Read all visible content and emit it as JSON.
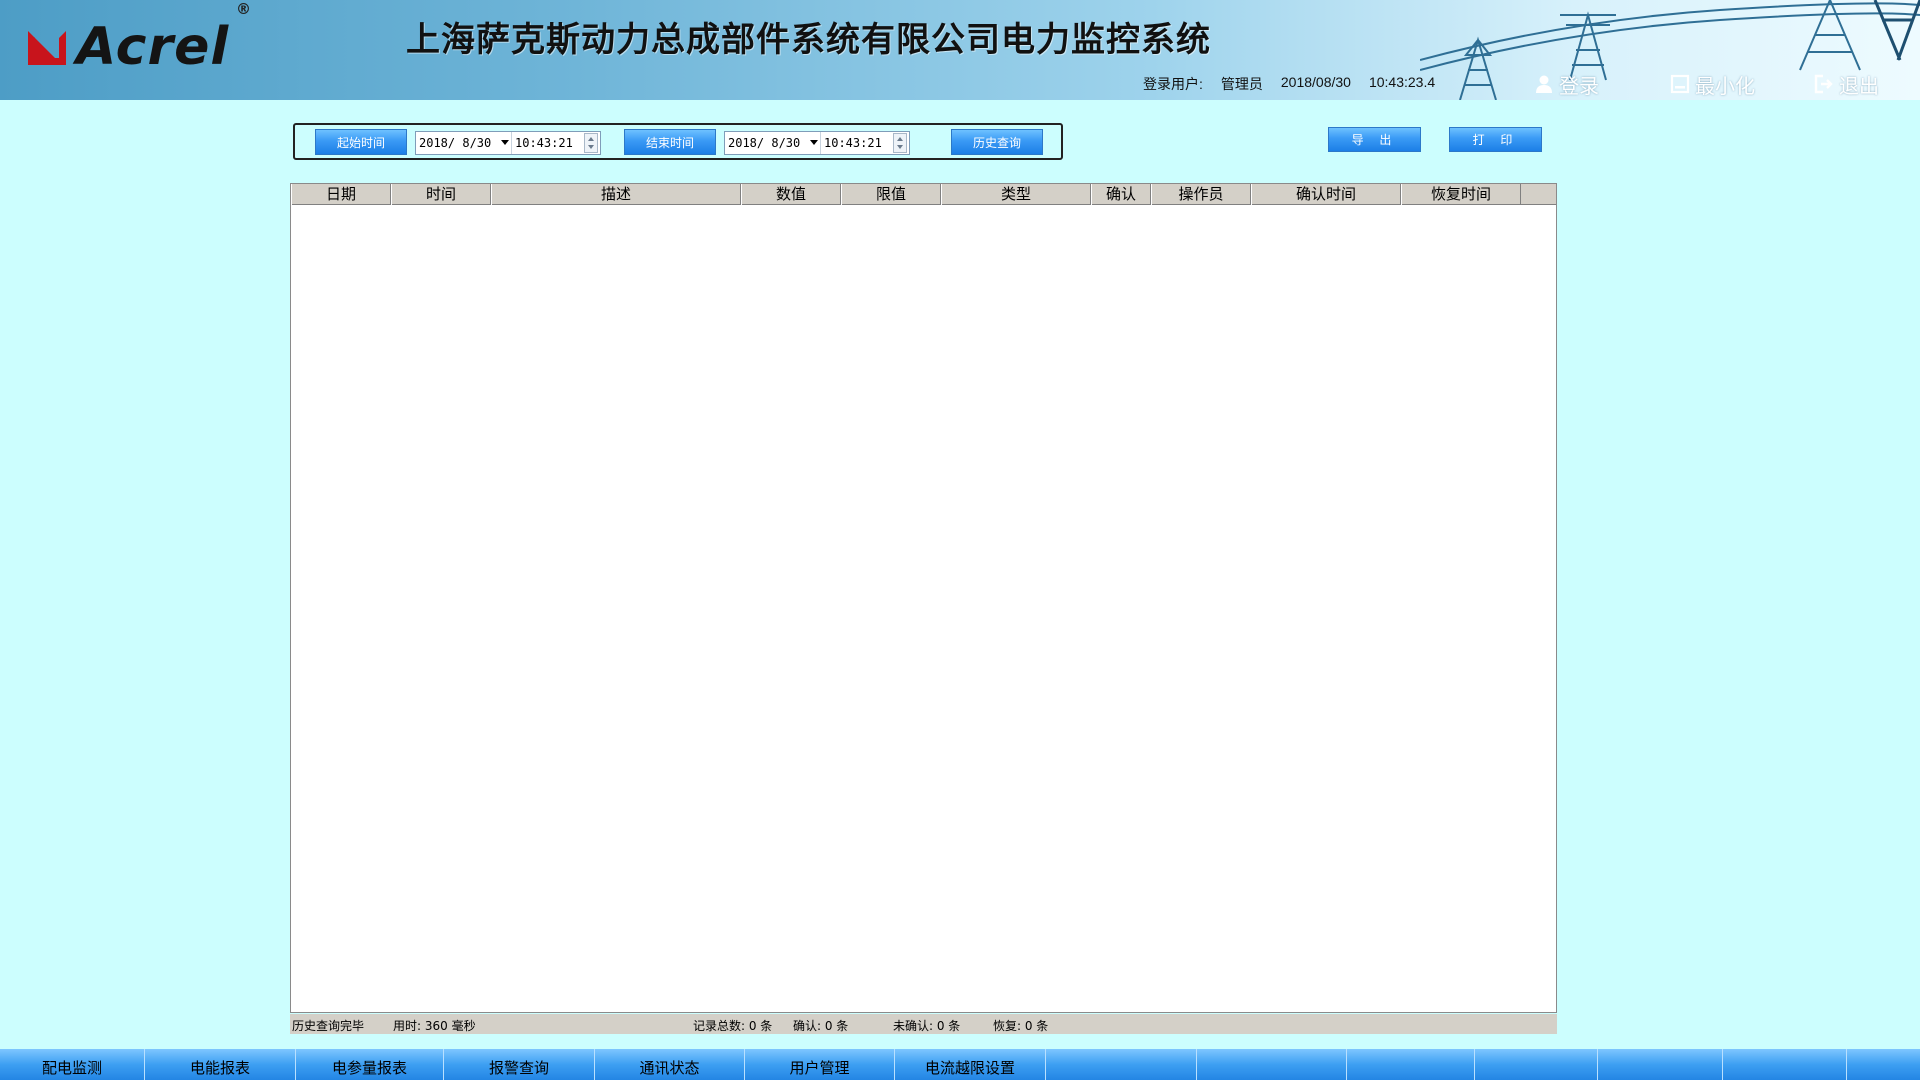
{
  "header": {
    "logo_text": "Acrel",
    "logo_reg": "®",
    "title": "上海萨克斯动力总成部件系统有限公司电力监控系统",
    "login_user_label": "登录用户:",
    "login_user": "管理员",
    "date": "2018/08/30",
    "time": "10:43:23.4",
    "buttons": {
      "login": "登录",
      "minimize": "最小化",
      "exit": "退出"
    }
  },
  "query": {
    "start_label": "起始时间",
    "start_date": "2018/ 8/30",
    "start_time": "10:43:21",
    "end_label": "结束时间",
    "end_date": "2018/ 8/30",
    "end_time": "10:43:21",
    "history_label": "历史查询"
  },
  "actions": {
    "export": "导 出",
    "print": "打 印"
  },
  "table": {
    "columns": [
      "日期",
      "时间",
      "描述",
      "数值",
      "限值",
      "类型",
      "确认",
      "操作员",
      "确认时间",
      "恢复时间"
    ],
    "rows": []
  },
  "status": {
    "message": "历史查询完毕",
    "elapsed": "用时: 360 毫秒",
    "total": "记录总数: 0 条",
    "confirmed": "确认: 0 条",
    "unconfirmed": "未确认: 0 条",
    "recovered": "恢复: 0 条"
  },
  "nav": {
    "items": [
      "配电监测",
      "电能报表",
      "电参量报表",
      "报警查询",
      "通讯状态",
      "用户管理",
      "电流越限设置",
      "",
      "",
      "",
      "",
      "",
      "",
      ""
    ]
  },
  "colors": {
    "background": "#ccfefe",
    "accent_blue": "#3a9af5",
    "logo_red": "#c8141c"
  }
}
